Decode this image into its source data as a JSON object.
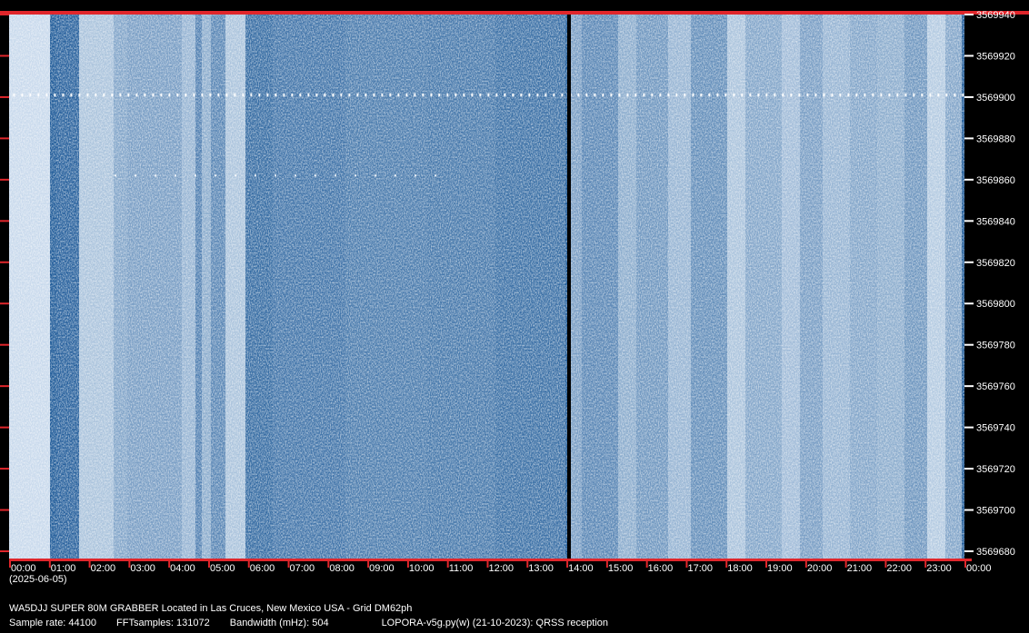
{
  "station": {
    "title": "WA5DJJ SUPER 80M GRABBER Located in Las Cruces, New Mexico USA - Grid DM62ph",
    "date": "(2025-06-05)",
    "sample_rate": "Sample rate: 44100",
    "fft_samples": "FFTsamples: 131072",
    "bandwidth": "Bandwidth (mHz): 504",
    "software": "LOPORA-v5g.py(w) (21-10-2023): QRSS reception"
  },
  "frequency_labels": [
    "3569940",
    "3569920",
    "3569900",
    "3569880",
    "3569860",
    "3569840",
    "3569820",
    "3569800",
    "3569780",
    "3569760",
    "3569740",
    "3569720",
    "3569700",
    "3569680"
  ],
  "time_labels": [
    "00:00",
    "01:00",
    "02:00",
    "03:00",
    "04:00",
    "05:00",
    "06:00",
    "07:00",
    "08:00",
    "09:00",
    "10:00",
    "11:00",
    "12:00",
    "13:00",
    "14:00",
    "15:00",
    "16:00",
    "17:00",
    "18:00",
    "19:00",
    "20:00",
    "21:00",
    "22:00",
    "23:00",
    "00:00"
  ],
  "colors": {
    "background": "#000000",
    "marker_red": "#e0262b",
    "waterfall_dark": "#1e5a98",
    "waterfall_light": "#e6f0fa",
    "text": "#ffffff"
  },
  "signals": [
    {
      "freq": 3569901,
      "start_hour": 0.1,
      "end_hour": 24.0
    },
    {
      "freq": 3569862,
      "start_hour": 2.65,
      "end_hour": 11.05
    }
  ]
}
